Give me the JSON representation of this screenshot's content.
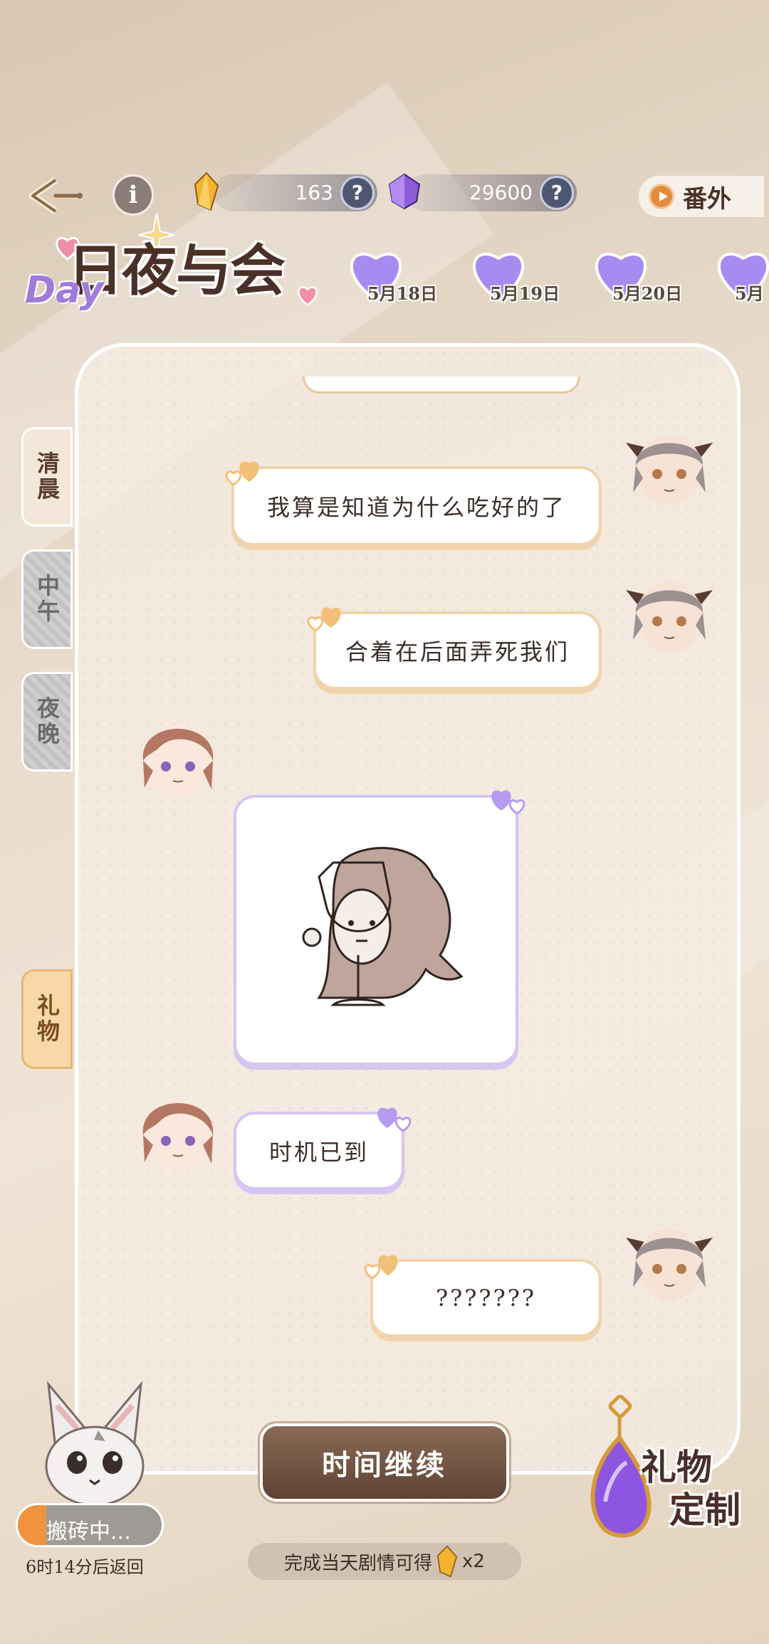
{
  "header": {
    "back_icon": "back-arrow-icon",
    "info_label": "i",
    "gold_currency": {
      "amount": "163",
      "help": "?",
      "icon": "gold-crystal-icon"
    },
    "purple_currency": {
      "amount": "29600",
      "help": "?",
      "icon": "purple-gem-icon"
    },
    "extra_button_label": "番外"
  },
  "title": {
    "main": "日夜与会",
    "accent": "Day"
  },
  "dates": [
    "5月18日",
    "5月19日",
    "5月20日",
    "5月"
  ],
  "side_tabs": {
    "morning": "清晨",
    "noon": "中午",
    "night": "夜晚",
    "gift": "礼物"
  },
  "messages": [
    {
      "side": "right",
      "text": "我算是知道为什么吃好的了"
    },
    {
      "side": "right",
      "text": "合着在后面弄死我们"
    },
    {
      "side": "left",
      "type": "sticker",
      "icon": "chibi-sticker-icon"
    },
    {
      "side": "left",
      "text": "时机已到"
    },
    {
      "side": "right",
      "text": "???????"
    }
  ],
  "bottom": {
    "continue_label": "时间继续",
    "reward_text": "完成当天剧情可得",
    "reward_count": "x2",
    "gift_custom_line1": "礼物",
    "gift_custom_line2": "定制",
    "pet_status": "搬砖中...",
    "pet_progress": 0.2,
    "pet_return": "6时14分后返回"
  },
  "colors": {
    "accent_orange": "#f1933c",
    "bubble_right_border": "#f0d4ac",
    "bubble_left_border": "#d6c6f2",
    "button_brown": "#6e5242"
  }
}
